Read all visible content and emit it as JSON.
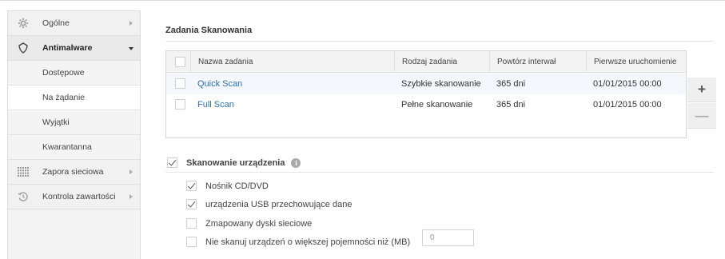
{
  "sidebar": {
    "items": [
      {
        "label": "Ogólne",
        "icon": "gear-icon"
      },
      {
        "label": "Antimalware",
        "icon": "shield-icon"
      },
      {
        "label": "Zapora sieciowa",
        "icon": "firewall-grid-icon"
      },
      {
        "label": "Kontrola zawartości",
        "icon": "content-control-icon"
      }
    ],
    "subitems": [
      {
        "label": "Dostępowe"
      },
      {
        "label": "Na żądanie"
      },
      {
        "label": "Wyjątki"
      },
      {
        "label": "Kwarantanna"
      }
    ]
  },
  "main": {
    "title": "Zadania Skanowania",
    "table": {
      "headers": [
        "Nazwa zadania",
        "Rodzaj zadania",
        "Powtórz interwał",
        "Pierwsze uruchomienie"
      ],
      "rows": [
        {
          "name": "Quick Scan",
          "type": "Szybkie skanowanie",
          "interval": "365 dni",
          "first_run": "01/01/2015 00:00"
        },
        {
          "name": "Full Scan",
          "type": "Pełne skanowanie",
          "interval": "365 dni",
          "first_run": "01/01/2015 00:00"
        }
      ]
    },
    "add_label": "+",
    "remove_label": "—",
    "device_scan": {
      "label": "Skanowanie urządzenia",
      "info_label": "i",
      "checked": true,
      "options": [
        {
          "label": "Nośnik CD/DVD",
          "checked": true
        },
        {
          "label": "urządzenia USB przechowujące dane",
          "checked": true
        },
        {
          "label": "Zmapowany dyski sieciowe",
          "checked": false
        },
        {
          "label": "Nie skanuj urządzeń o większej pojemności niż (MB)",
          "checked": false
        }
      ],
      "size_value": "0"
    }
  },
  "colors": {
    "link": "#2a6fb5",
    "sidebar_bg": "#f4f4f4",
    "row_alt": "#f4f8fc"
  }
}
